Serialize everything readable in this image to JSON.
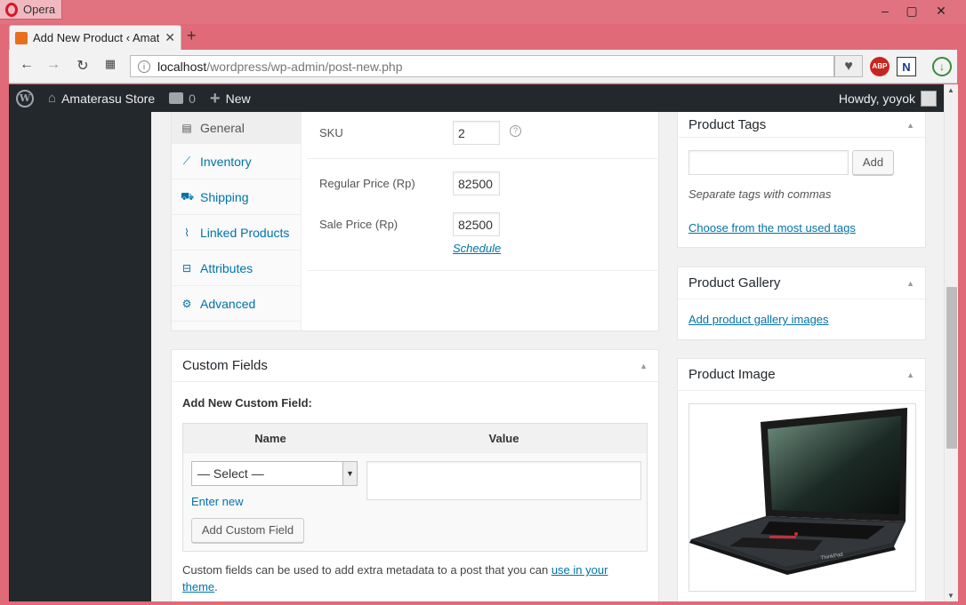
{
  "browser": {
    "app_name": "Opera",
    "tab_title": "Add New Product ‹ Amate",
    "url_host": "localhost",
    "url_path": "/wordpress/wp-admin/post-new.php",
    "extension_abp": "ABP",
    "extension_n": "N"
  },
  "adminbar": {
    "site_name": "Amaterasu Store",
    "comments_count": "0",
    "new_label": "New",
    "howdy": "Howdy, yoyok"
  },
  "product_data": {
    "tabs": [
      {
        "label": "General",
        "icon": "general-icon"
      },
      {
        "label": "Inventory",
        "icon": "inventory-icon"
      },
      {
        "label": "Shipping",
        "icon": "shipping-icon"
      },
      {
        "label": "Linked Products",
        "icon": "link-icon"
      },
      {
        "label": "Attributes",
        "icon": "attributes-icon"
      },
      {
        "label": "Advanced",
        "icon": "gear-icon"
      }
    ],
    "sku_label": "SKU",
    "sku_value": "2",
    "regular_price_label": "Regular Price (Rp)",
    "regular_price_value": "82500",
    "sale_price_label": "Sale Price (Rp)",
    "sale_price_value": "82500",
    "schedule_link": "Schedule"
  },
  "custom_fields": {
    "title": "Custom Fields",
    "subtitle": "Add New Custom Field:",
    "col_name": "Name",
    "col_value": "Value",
    "select_value": "— Select —",
    "enter_new": "Enter new",
    "add_button": "Add Custom Field",
    "note_text": "Custom fields can be used to add extra metadata to a post that you can ",
    "note_link": "use in your theme",
    "note_end": "."
  },
  "product_tags": {
    "title": "Product Tags",
    "add_button": "Add",
    "hint": "Separate tags with commas",
    "most_used_link": "Choose from the most used tags"
  },
  "product_gallery": {
    "title": "Product Gallery",
    "add_link": "Add product gallery images"
  },
  "product_image": {
    "title": "Product Image",
    "brand": "ThinkPad"
  }
}
